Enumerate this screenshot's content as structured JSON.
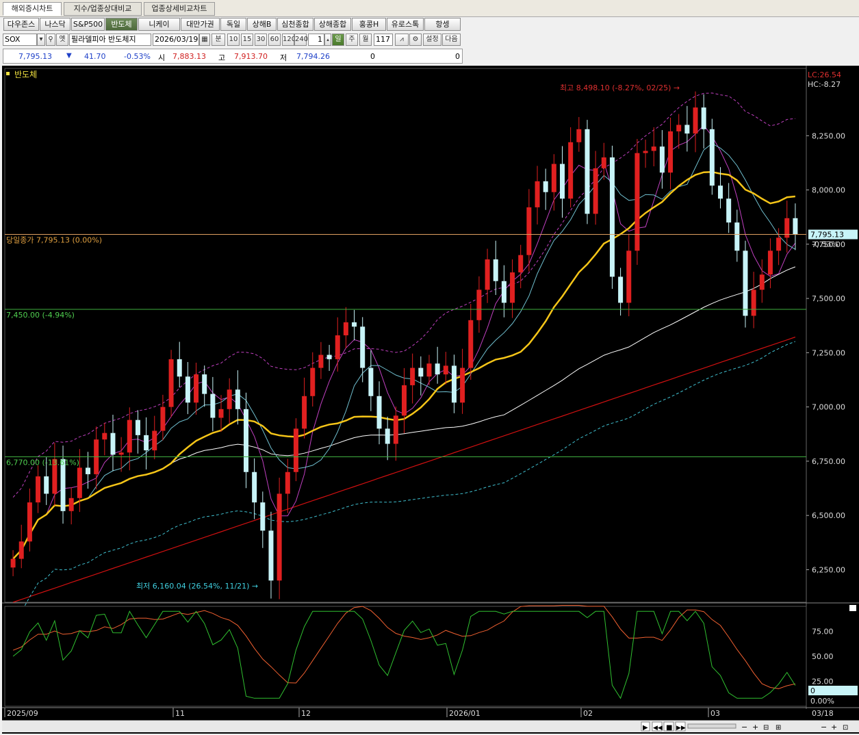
{
  "tabs": [
    "해외증시차트",
    "지수/업종상대비교",
    "업종상세비교차트"
  ],
  "markets": [
    "다우존스",
    "나스닥",
    "S&P500",
    "반도체",
    "니케이",
    "대만가권",
    "독일",
    "상해B",
    "심천종합",
    "상해종합",
    "홍콩H",
    "유로스톡",
    "항셍"
  ],
  "toolbar": {
    "symbol": "SOX",
    "symbol_flag": "옛",
    "symbol_name": "필라델피아 반도체지",
    "date": "2026/03/19",
    "unit_minute": "분",
    "intervals": [
      "10",
      "15",
      "30",
      "60",
      "120",
      "240"
    ],
    "count": "1",
    "period_day": "일",
    "period_week": "주",
    "period_month": "월",
    "bar_count": "117",
    "settings": "설정",
    "next": "다음"
  },
  "quote": {
    "price": "7,795.13",
    "arrow": "▼",
    "change": "41.70",
    "change_pct": "-0.53%",
    "open_label": "시",
    "open": "7,883.13",
    "high_label": "고",
    "high": "7,913.70",
    "low_label": "저",
    "low": "7,794.26",
    "vol1": "0",
    "vol2": "0"
  },
  "chart": {
    "title": "반도체",
    "lc": "LC:26.54",
    "hc": "HC:-8.27",
    "close_label": "당일종가 7,795.13 (0.00%)",
    "hline1_label": "7,450.00 (-4.94%)",
    "hline2_label": "6,770.00 (-13.61%)",
    "high_note": "최고 8,498.10 (-8.27%, 02/25)",
    "low_note": "최저 6,160.04 (26.54%, 11/21)",
    "price_box": "7,795.13",
    "price_box_pct": "-0.53%",
    "osc_box": "0",
    "osc_pct": "0.00%",
    "date_labels": [
      "2025/09",
      "11",
      "12",
      "2026/01",
      "02",
      "03"
    ],
    "last_date": "03/18",
    "colors": {
      "up": "#e02020",
      "down": "#c8f4f8",
      "ma20": "#f5c518",
      "ma60": "#ffffff",
      "ma120": "#d01010",
      "envelope": "#c040c0",
      "hline": "#40b040",
      "closeline": "#e0a060"
    }
  },
  "chart_data": {
    "type": "candlestick",
    "title": "반도체",
    "y_ticks": [
      6250,
      6500,
      6750,
      7000,
      7250,
      7500,
      7750,
      8000,
      8250
    ],
    "y_tick_labels": [
      "6,250.00",
      "6,500.00",
      "6,750.00",
      "7,000.00",
      "7,250.00",
      "7,500.00",
      "7,750.00",
      "8,000.00",
      "8,250.00"
    ],
    "ylim": [
      6100,
      8560
    ],
    "close_series": [
      6300,
      6380,
      6560,
      6680,
      6600,
      6760,
      6520,
      6580,
      6720,
      6690,
      6850,
      6880,
      6780,
      6790,
      6940,
      6870,
      6800,
      6890,
      7000,
      7220,
      7140,
      7020,
      7150,
      7060,
      6950,
      6990,
      7080,
      6990,
      6700,
      6560,
      6430,
      6200,
      6600,
      6700,
      6900,
      7050,
      7180,
      7240,
      7220,
      7330,
      7390,
      7370,
      7180,
      7050,
      6900,
      6830,
      6960,
      7100,
      7180,
      7140,
      7200,
      7150,
      7190,
      7020,
      7180,
      7400,
      7540,
      7680,
      7580,
      7480,
      7620,
      7700,
      7920,
      8040,
      7990,
      8120,
      7960,
      8220,
      8280,
      7890,
      8100,
      8150,
      7600,
      7480,
      7720,
      8170,
      8180,
      8200,
      8080,
      8270,
      8300,
      8260,
      8380,
      8280,
      8020,
      7960,
      7850,
      7720,
      7420,
      7540,
      7610,
      7720,
      7780,
      7870,
      7795
    ],
    "ma_periods": [
      5,
      20,
      60,
      120
    ],
    "hlines": [
      7795.13,
      7450.0,
      6770.0
    ],
    "oscillator_ticks": [
      "75.00",
      "50.00",
      "25.00"
    ]
  }
}
